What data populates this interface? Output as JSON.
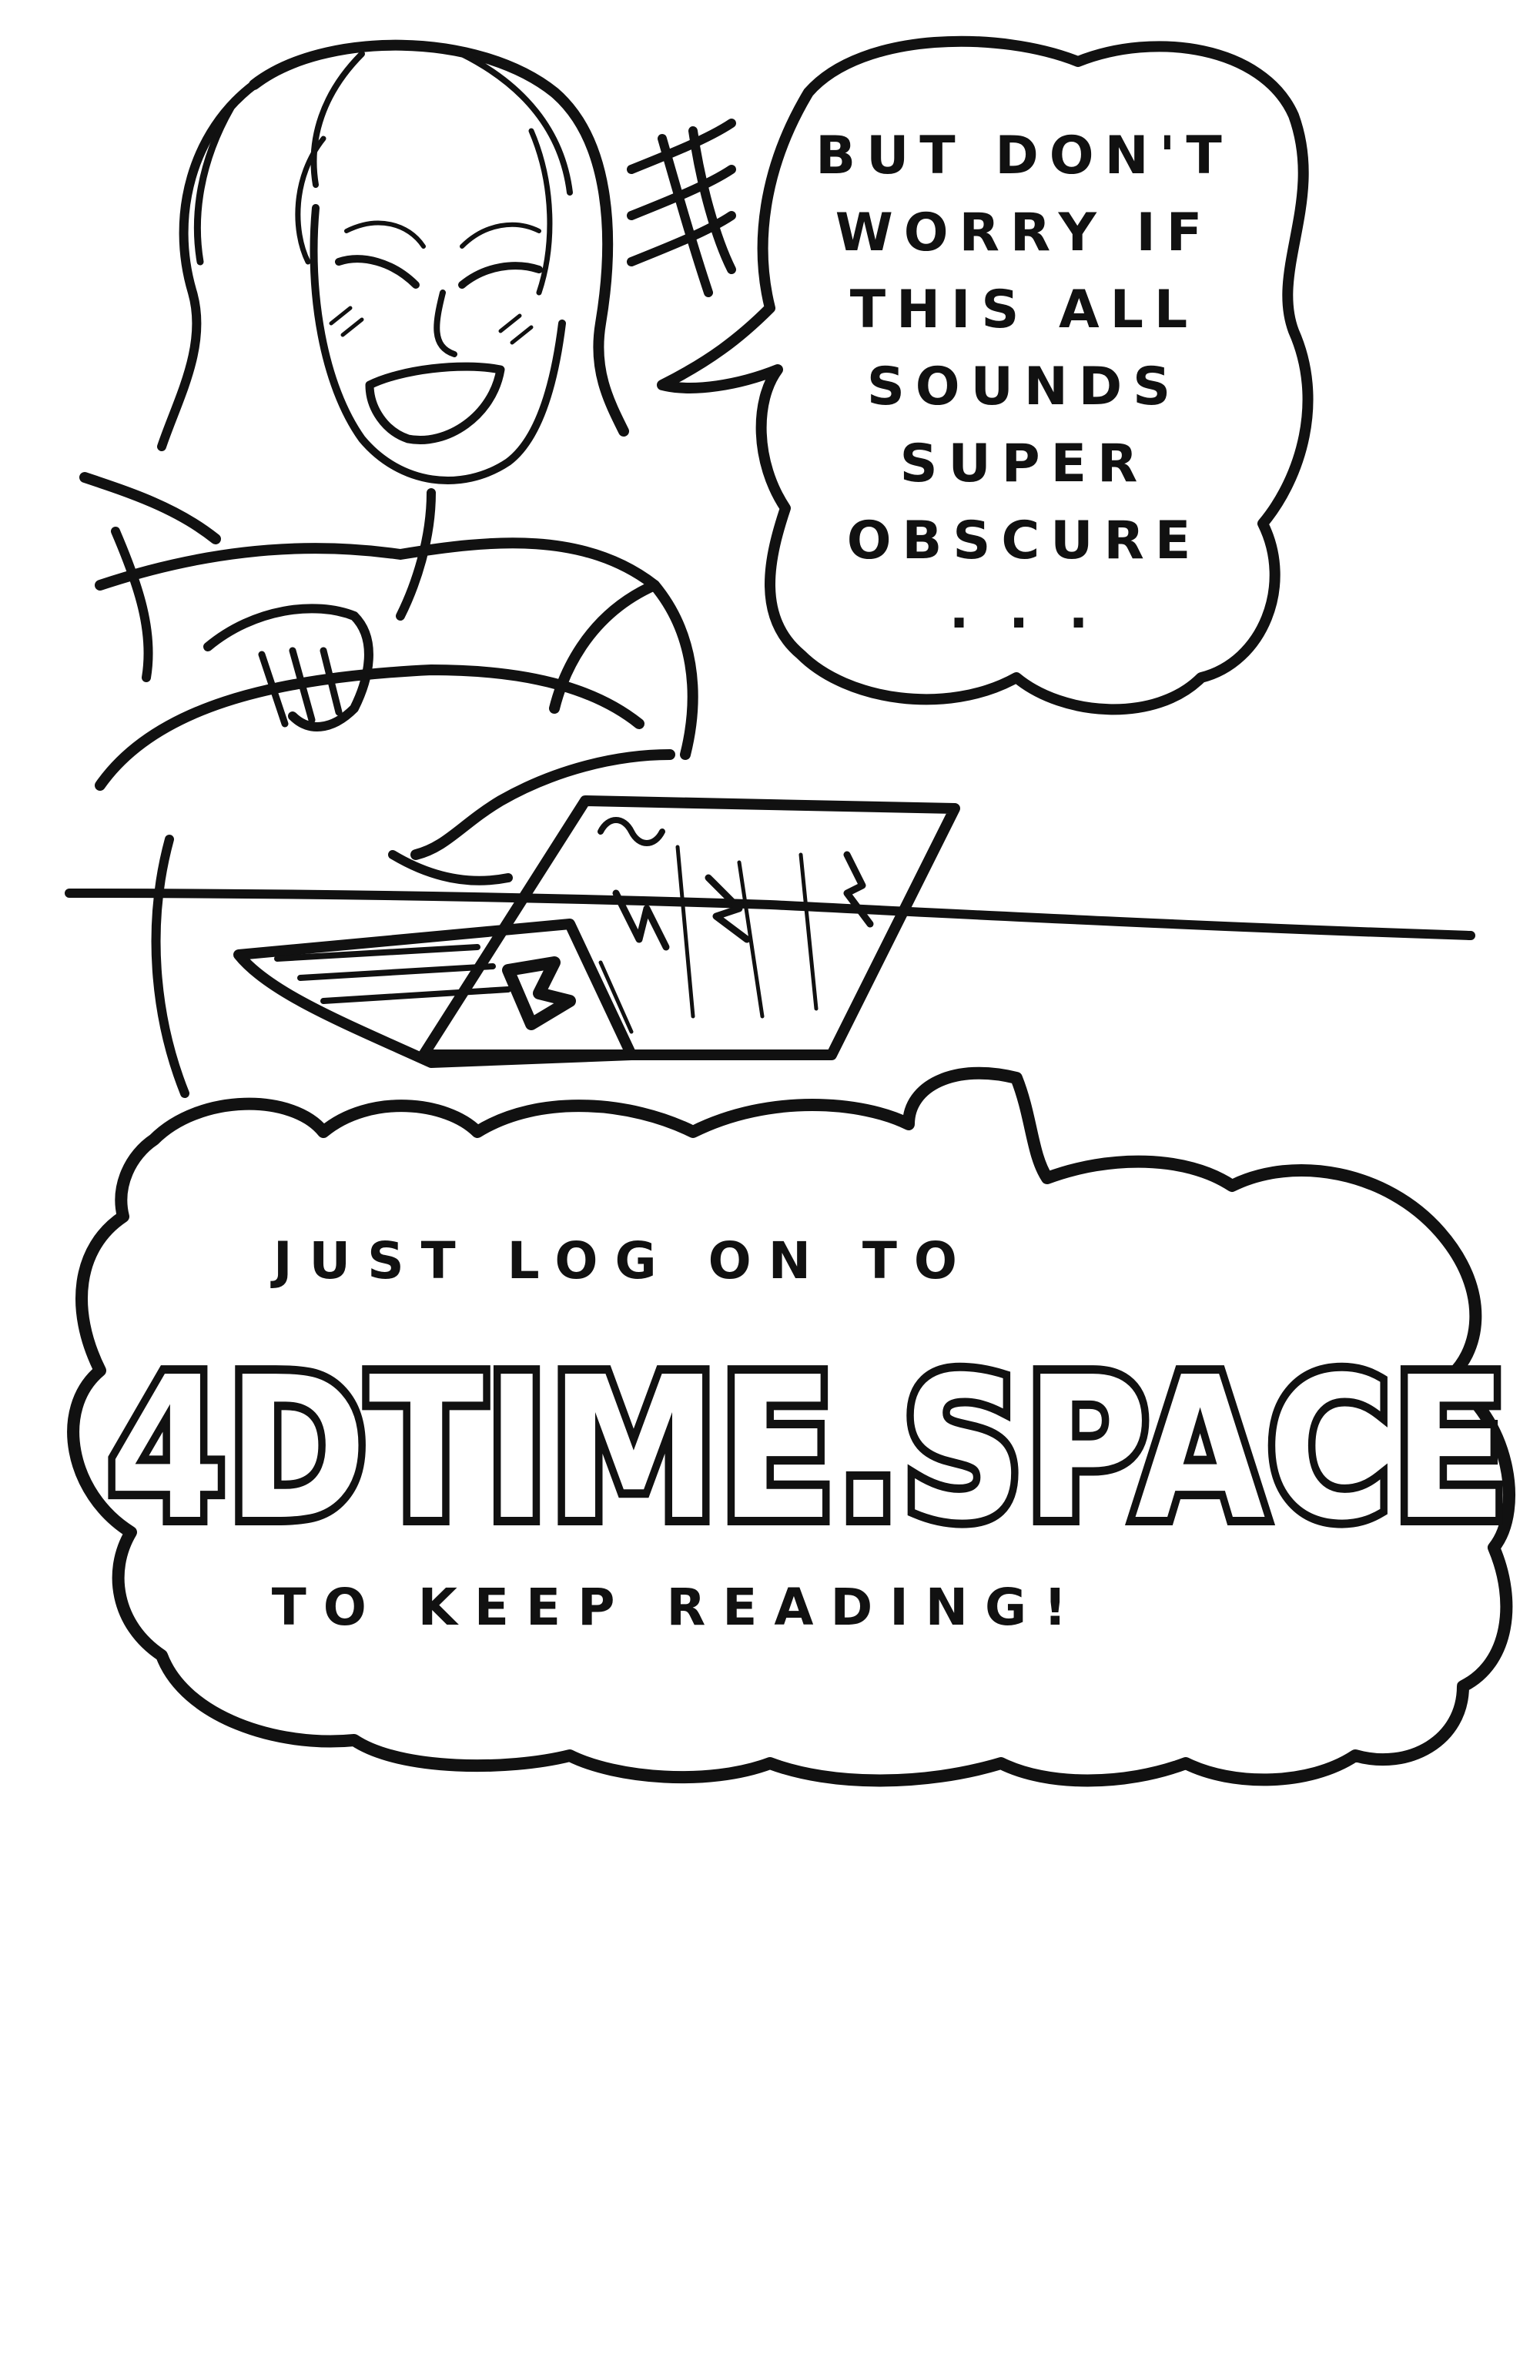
{
  "speech_bubble": {
    "lines": [
      "BUT DON'T",
      "WORRY IF",
      "THIS ALL",
      "SOUNDS",
      "SUPER",
      "OBSCURE",
      ". . ."
    ]
  },
  "caption_bubble": {
    "top": "JUST LOG ON TO",
    "url": "4DTIME.SPACE",
    "bottom": "TO KEEP READING!"
  },
  "colors": {
    "ink": "#111111",
    "paper": "#ffffff"
  }
}
